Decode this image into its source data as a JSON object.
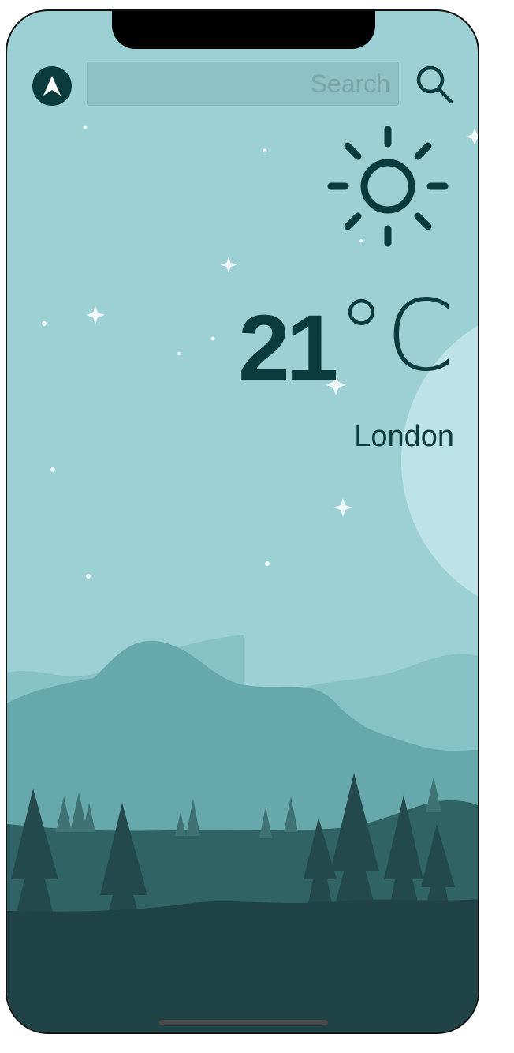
{
  "search": {
    "placeholder": "Search",
    "value": ""
  },
  "weather": {
    "temperature": "21",
    "unit": "°C",
    "city": "London",
    "condition_icon": "sun-icon"
  },
  "icons": {
    "location": "navigation-arrow-icon",
    "search": "magnifier-icon"
  },
  "colors": {
    "sky": "#9cd0d4",
    "accent": "#0c3b3e",
    "moon": "#bde3e8",
    "hills_far": "#87c3c6",
    "hills_mid": "#66a8ab",
    "hills_near": "#2f6366",
    "ground": "#1f4346"
  }
}
